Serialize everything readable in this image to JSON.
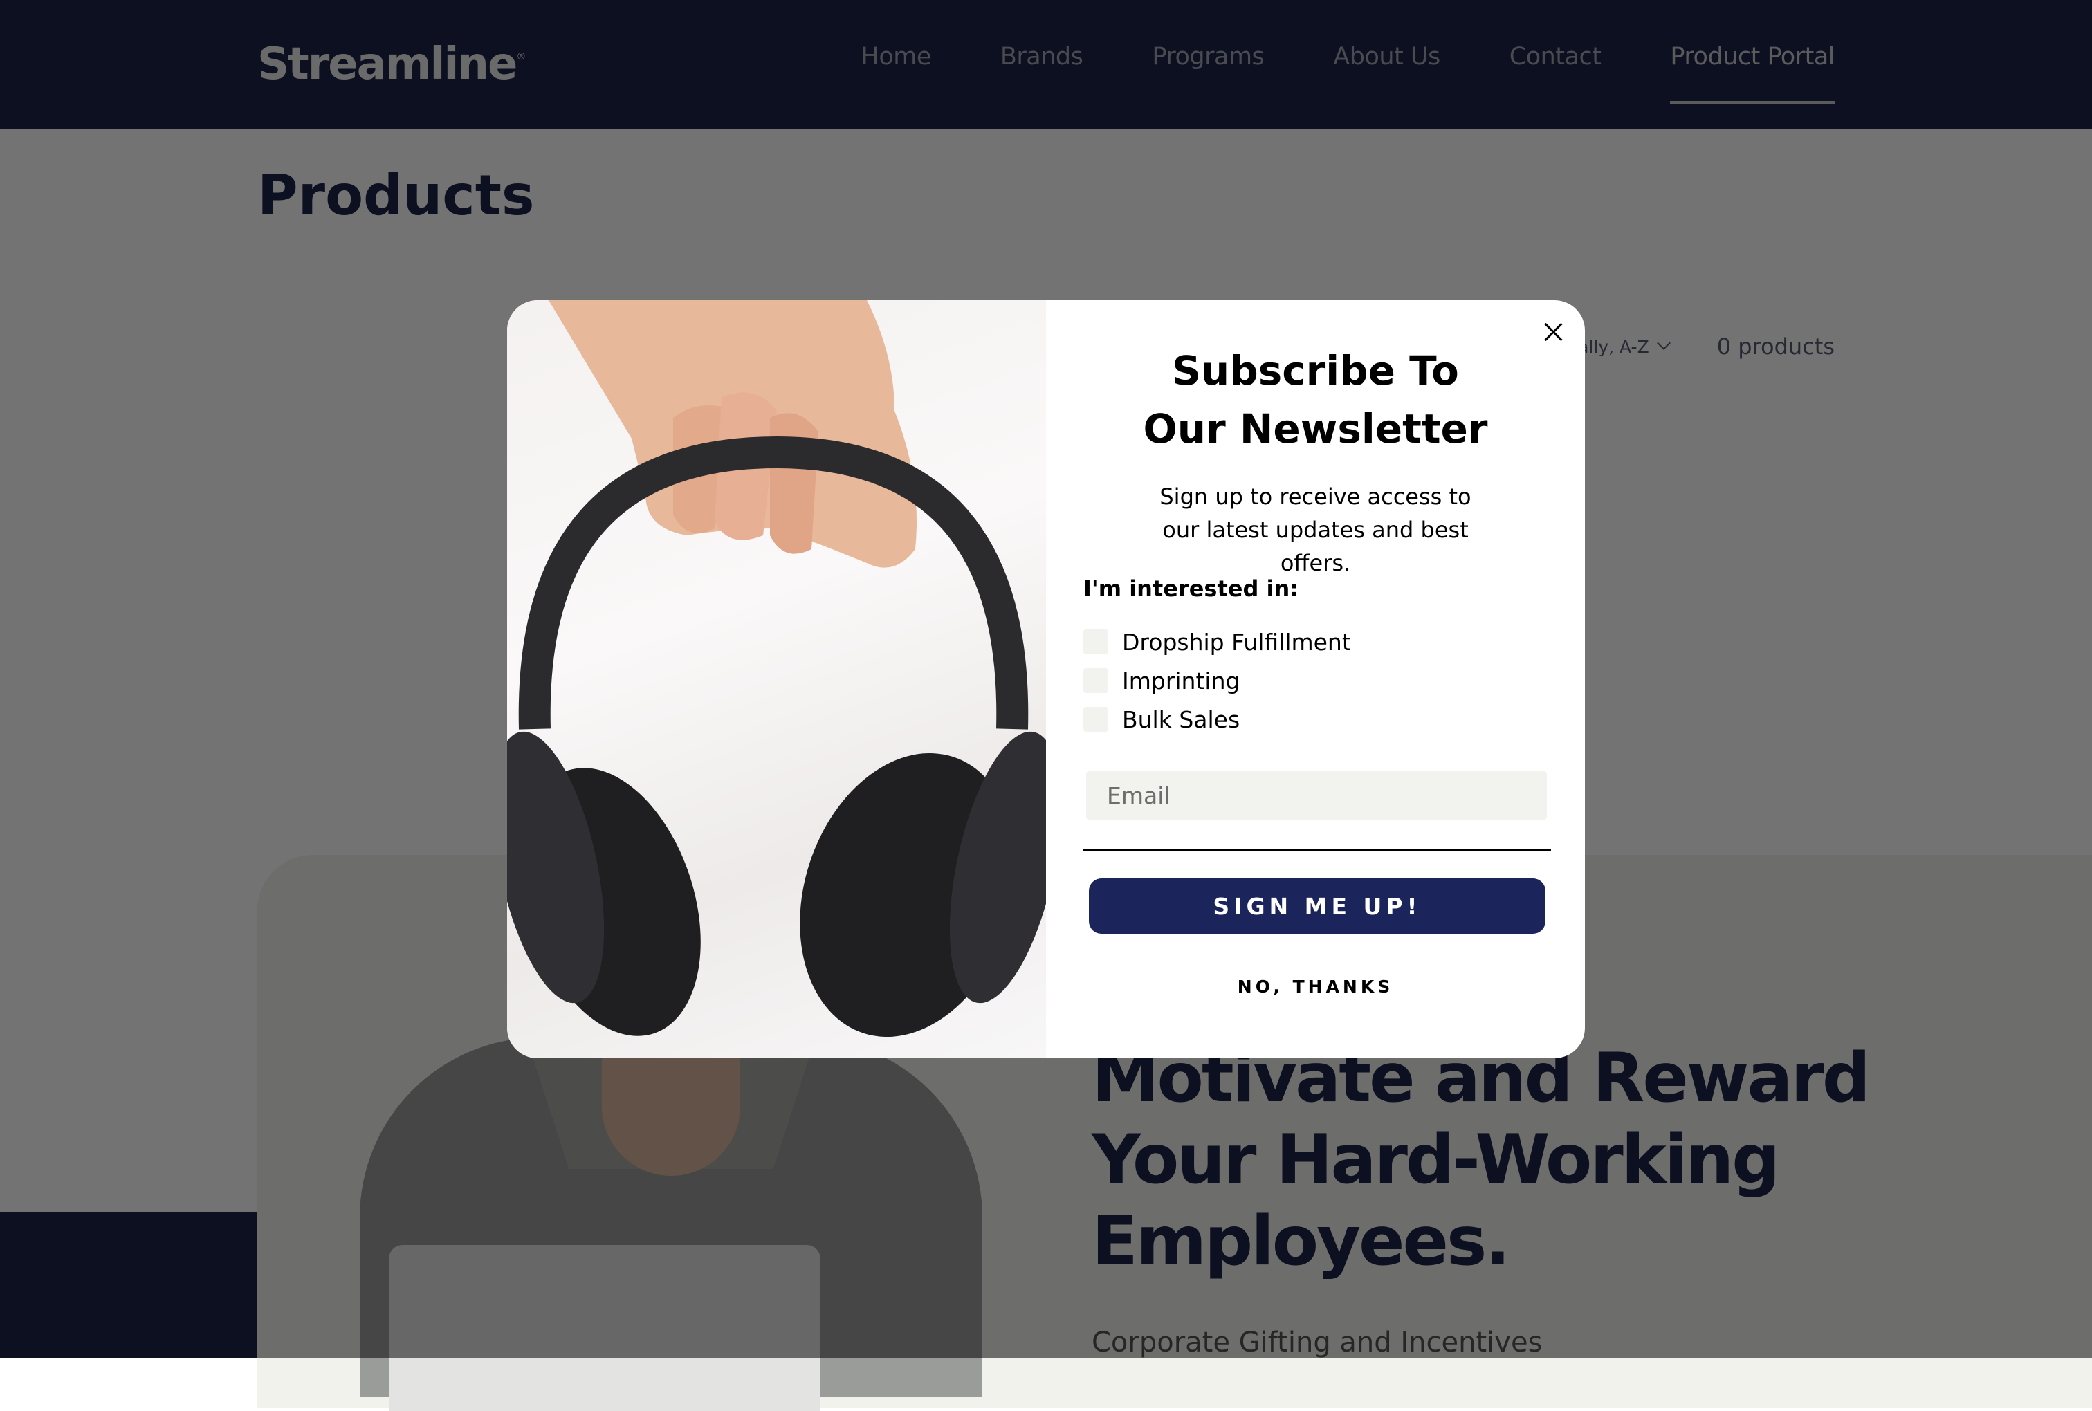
{
  "header": {
    "logo": "Streamline",
    "logo_mark": "®",
    "nav": [
      {
        "label": "Home",
        "active": false
      },
      {
        "label": "Brands",
        "active": false
      },
      {
        "label": "Programs",
        "active": false
      },
      {
        "label": "About Us",
        "active": false
      },
      {
        "label": "Contact",
        "active": false
      },
      {
        "label": "Product Portal",
        "active": true
      }
    ]
  },
  "page": {
    "title": "Products",
    "sort_label": "Alphabetically, A-Z",
    "sort_visible": "ally, A-Z",
    "product_count": "0 products"
  },
  "hero": {
    "title": "Motivate and Reward Your Hard-Working Employees.",
    "subtitle": "Corporate Gifting and Incentives"
  },
  "popup": {
    "image_alt": "Hand holding black over-ear headphones",
    "title": "Subscribe To Our Newsletter",
    "description": "Sign up to receive access to our latest updates and best offers.",
    "interest_label": "I'm interested in:",
    "options": [
      {
        "label": "Dropship Fulfillment",
        "checked": false
      },
      {
        "label": "Imprinting",
        "checked": false
      },
      {
        "label": "Bulk Sales",
        "checked": false
      }
    ],
    "email_placeholder": "Email",
    "email_value": "",
    "submit_label": "SIGN ME UP!",
    "decline_label": "NO, THANKS",
    "close_icon": "close-icon"
  },
  "colors": {
    "brand_navy": "#1c2447",
    "button_navy": "#1b255b"
  }
}
